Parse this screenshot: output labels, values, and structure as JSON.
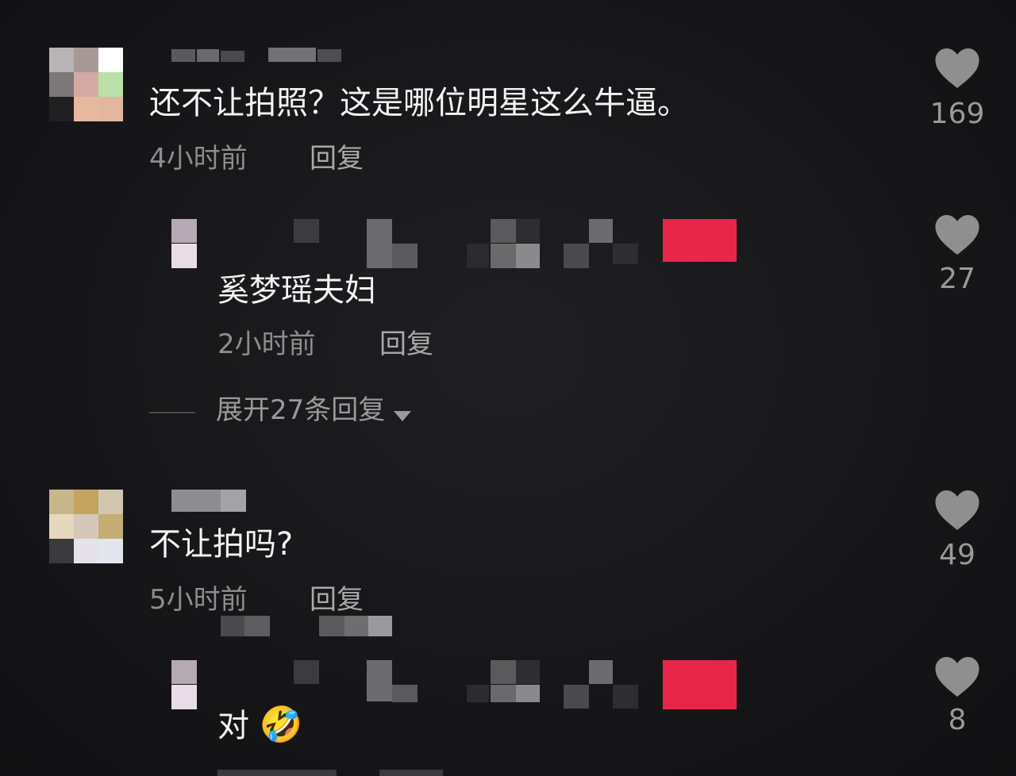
{
  "comments": [
    {
      "text": "还不让拍照？这是哪位明星这么牛逼。",
      "time": "4小时前",
      "reply_label": "回复",
      "likes": "169",
      "reply": {
        "text": "奚梦瑶夫妇",
        "time": "2小时前",
        "reply_label": "回复",
        "likes": "27"
      },
      "expand_label": "展开27条回复"
    },
    {
      "text": "不让拍吗?",
      "time": "5小时前",
      "reply_label": "回复",
      "likes": "49",
      "reply": {
        "text": "对",
        "emoji": "🤣",
        "likes": "8"
      }
    }
  ],
  "colors": {
    "background": "#17171a",
    "author_badge": "#e8264a",
    "heart": "#8f8f8f"
  },
  "icons": [
    "heart-icon",
    "chevron-down-icon"
  ]
}
